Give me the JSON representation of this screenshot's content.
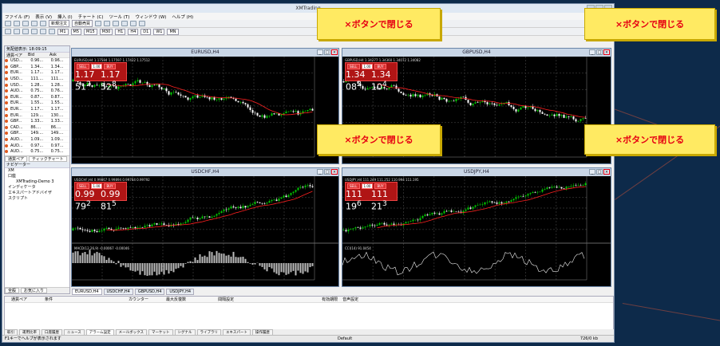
{
  "app": {
    "title": "XMTrading"
  },
  "menu": [
    "ファイル (F)",
    "表示 (V)",
    "挿入 (I)",
    "チャート (C)",
    "ツール (T)",
    "ウィンドウ (W)",
    "ヘルプ (H)"
  ],
  "toolbar": {
    "new_order": "新規注文",
    "auto_trade": "自動売買",
    "timeframes": [
      "M1",
      "M5",
      "M15",
      "M30",
      "H1",
      "H4",
      "D1",
      "W1",
      "MN"
    ]
  },
  "watchlist": {
    "title": "気配値表示: 18:09:15",
    "columns": [
      "通貨ペア",
      "Bid",
      "Ask"
    ],
    "rows": [
      [
        "USD...",
        "0.96...",
        "0.96..."
      ],
      [
        "GBP...",
        "1.34...",
        "1.34..."
      ],
      [
        "EUR...",
        "1.17...",
        "1.17..."
      ],
      [
        "USD...",
        "111....",
        "111...."
      ],
      [
        "USD...",
        "1.28...",
        "1.28..."
      ],
      [
        "AUD...",
        "0.75...",
        "0.76..."
      ],
      [
        "EUR...",
        "0.87...",
        "0.87..."
      ],
      [
        "EUR...",
        "1.55...",
        "1.55..."
      ],
      [
        "EUR...",
        "1.17...",
        "1.17..."
      ],
      [
        "EUR...",
        "129....",
        "130...."
      ],
      [
        "GBP...",
        "1.33...",
        "1.33..."
      ],
      [
        "CAD...",
        "86....",
        "86...."
      ],
      [
        "GBP...",
        "149....",
        "149...."
      ],
      [
        "AUD...",
        "1.09...",
        "1.09..."
      ],
      [
        "AUD...",
        "0.97...",
        "0.97..."
      ],
      [
        "AUD...",
        "0.75...",
        "0.75..."
      ]
    ],
    "tabs": [
      "通貨ペア",
      "ティックチャート"
    ]
  },
  "navigator": {
    "title": "ナビゲーター",
    "items": [
      "XM",
      "口座",
      "XMTrading-Demo 3",
      "インディケータ",
      "エキスパートアドバイザ",
      "スクリプト"
    ],
    "tabs": [
      "全般",
      "お気に入り"
    ]
  },
  "charts": [
    {
      "title": "EURUSD,H4",
      "symbol": "EURUSD,H4  1.17584 1.17597 1.17422 1.17512",
      "sell_label": "SELL",
      "buy_label": "BUY",
      "lot": "1.00",
      "sell_big": "1.17 51",
      "sell_sup": "2",
      "buy_big": "1.17 52",
      "buy_sup": "8",
      "subwindow": "",
      "seed": 1,
      "trend": "down"
    },
    {
      "title": "GBPUSD,H4",
      "symbol": "GBPUSD,H4  1.34277 1.34360 1.34072 1.34082",
      "sell_label": "SELL",
      "buy_label": "BUY",
      "lot": "1.00",
      "sell_big": "1.34 08",
      "sell_sup": "2",
      "buy_big": "1.34 10",
      "buy_sup": "4",
      "subwindow": "",
      "seed": 2,
      "trend": "down"
    },
    {
      "title": "USDCHF,H4",
      "symbol": "USDCHF,H4  0.99867 0.99894 0.99764 0.99792",
      "sell_label": "SELL",
      "buy_label": "BUY",
      "lot": "1.00",
      "sell_big": "0.99 79",
      "sell_sup": "2",
      "buy_big": "0.99 81",
      "buy_sup": "5",
      "subwindow": "MACD(12,26,9) -0.00067 -0.00046",
      "seed": 3,
      "trend": "up"
    },
    {
      "title": "USDJPY,H4",
      "symbol": "USDJPY,H4  111.249 111.252 110.994 111.195",
      "sell_label": "SELL",
      "buy_label": "BUY",
      "lot": "1.00",
      "sell_big": "111 19",
      "sell_sup": "6",
      "buy_big": "111 21",
      "buy_sup": "3",
      "subwindow": "CCI(14) 91.0454",
      "seed": 4,
      "trend": "up"
    }
  ],
  "callouts": [
    "×ボタンで閉じる",
    "×ボタンで閉じる",
    "×ボタンで閉じる",
    "×ボタンで閉じる"
  ],
  "chart_tabs": [
    "EURUSD,H4",
    "USDCHF,H4",
    "GBPUSD,H4",
    "USDJPY,H4"
  ],
  "terminal": {
    "columns": [
      "通貨ペア",
      "条件",
      "カウンター",
      "最大反復数",
      "間隔設定",
      "有効期限",
      "音声設定"
    ],
    "tabs": [
      "取引",
      "運用比率",
      "口座履歴",
      "ニュース",
      "アラーム設定",
      "メールボックス",
      "マーケット",
      "シグナル",
      "ライブラリ",
      "エキスパート",
      "操作履歴"
    ]
  },
  "status": {
    "help": "F1キーでヘルプが表示されます",
    "profile": "Default",
    "traffic": "726/0 kb"
  },
  "colors": {
    "callout_bg": "#ffea62",
    "callout_text": "#e60012",
    "close_highlight": "#e60012",
    "bull": "#00cc00",
    "bear": "#ffffff",
    "ma": "#ff2020"
  }
}
